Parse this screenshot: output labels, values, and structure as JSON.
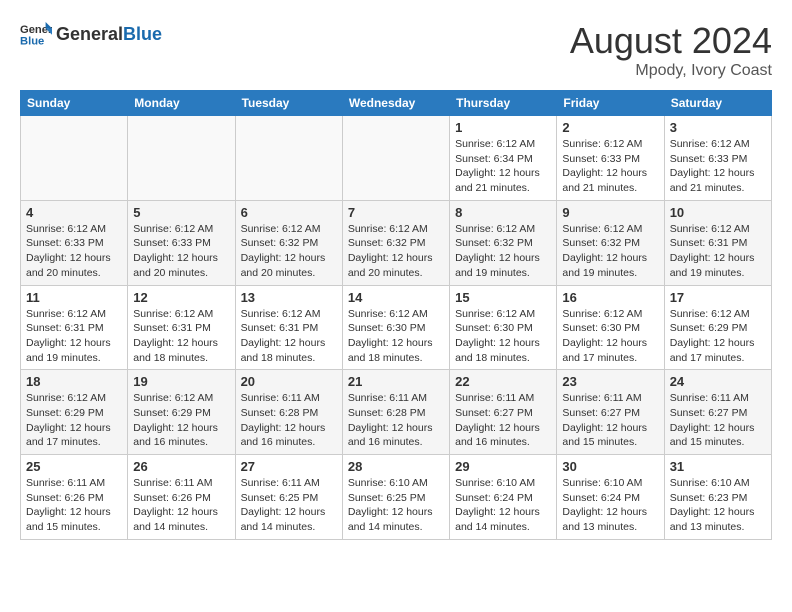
{
  "header": {
    "logo_general": "General",
    "logo_blue": "Blue",
    "month_year": "August 2024",
    "location": "Mpody, Ivory Coast"
  },
  "weekdays": [
    "Sunday",
    "Monday",
    "Tuesday",
    "Wednesday",
    "Thursday",
    "Friday",
    "Saturday"
  ],
  "weeks": [
    [
      {
        "day": "",
        "detail": ""
      },
      {
        "day": "",
        "detail": ""
      },
      {
        "day": "",
        "detail": ""
      },
      {
        "day": "",
        "detail": ""
      },
      {
        "day": "1",
        "detail": "Sunrise: 6:12 AM\nSunset: 6:34 PM\nDaylight: 12 hours\nand 21 minutes."
      },
      {
        "day": "2",
        "detail": "Sunrise: 6:12 AM\nSunset: 6:33 PM\nDaylight: 12 hours\nand 21 minutes."
      },
      {
        "day": "3",
        "detail": "Sunrise: 6:12 AM\nSunset: 6:33 PM\nDaylight: 12 hours\nand 21 minutes."
      }
    ],
    [
      {
        "day": "4",
        "detail": "Sunrise: 6:12 AM\nSunset: 6:33 PM\nDaylight: 12 hours\nand 20 minutes."
      },
      {
        "day": "5",
        "detail": "Sunrise: 6:12 AM\nSunset: 6:33 PM\nDaylight: 12 hours\nand 20 minutes."
      },
      {
        "day": "6",
        "detail": "Sunrise: 6:12 AM\nSunset: 6:32 PM\nDaylight: 12 hours\nand 20 minutes."
      },
      {
        "day": "7",
        "detail": "Sunrise: 6:12 AM\nSunset: 6:32 PM\nDaylight: 12 hours\nand 20 minutes."
      },
      {
        "day": "8",
        "detail": "Sunrise: 6:12 AM\nSunset: 6:32 PM\nDaylight: 12 hours\nand 19 minutes."
      },
      {
        "day": "9",
        "detail": "Sunrise: 6:12 AM\nSunset: 6:32 PM\nDaylight: 12 hours\nand 19 minutes."
      },
      {
        "day": "10",
        "detail": "Sunrise: 6:12 AM\nSunset: 6:31 PM\nDaylight: 12 hours\nand 19 minutes."
      }
    ],
    [
      {
        "day": "11",
        "detail": "Sunrise: 6:12 AM\nSunset: 6:31 PM\nDaylight: 12 hours\nand 19 minutes."
      },
      {
        "day": "12",
        "detail": "Sunrise: 6:12 AM\nSunset: 6:31 PM\nDaylight: 12 hours\nand 18 minutes."
      },
      {
        "day": "13",
        "detail": "Sunrise: 6:12 AM\nSunset: 6:31 PM\nDaylight: 12 hours\nand 18 minutes."
      },
      {
        "day": "14",
        "detail": "Sunrise: 6:12 AM\nSunset: 6:30 PM\nDaylight: 12 hours\nand 18 minutes."
      },
      {
        "day": "15",
        "detail": "Sunrise: 6:12 AM\nSunset: 6:30 PM\nDaylight: 12 hours\nand 18 minutes."
      },
      {
        "day": "16",
        "detail": "Sunrise: 6:12 AM\nSunset: 6:30 PM\nDaylight: 12 hours\nand 17 minutes."
      },
      {
        "day": "17",
        "detail": "Sunrise: 6:12 AM\nSunset: 6:29 PM\nDaylight: 12 hours\nand 17 minutes."
      }
    ],
    [
      {
        "day": "18",
        "detail": "Sunrise: 6:12 AM\nSunset: 6:29 PM\nDaylight: 12 hours\nand 17 minutes."
      },
      {
        "day": "19",
        "detail": "Sunrise: 6:12 AM\nSunset: 6:29 PM\nDaylight: 12 hours\nand 16 minutes."
      },
      {
        "day": "20",
        "detail": "Sunrise: 6:11 AM\nSunset: 6:28 PM\nDaylight: 12 hours\nand 16 minutes."
      },
      {
        "day": "21",
        "detail": "Sunrise: 6:11 AM\nSunset: 6:28 PM\nDaylight: 12 hours\nand 16 minutes."
      },
      {
        "day": "22",
        "detail": "Sunrise: 6:11 AM\nSunset: 6:27 PM\nDaylight: 12 hours\nand 16 minutes."
      },
      {
        "day": "23",
        "detail": "Sunrise: 6:11 AM\nSunset: 6:27 PM\nDaylight: 12 hours\nand 15 minutes."
      },
      {
        "day": "24",
        "detail": "Sunrise: 6:11 AM\nSunset: 6:27 PM\nDaylight: 12 hours\nand 15 minutes."
      }
    ],
    [
      {
        "day": "25",
        "detail": "Sunrise: 6:11 AM\nSunset: 6:26 PM\nDaylight: 12 hours\nand 15 minutes."
      },
      {
        "day": "26",
        "detail": "Sunrise: 6:11 AM\nSunset: 6:26 PM\nDaylight: 12 hours\nand 14 minutes."
      },
      {
        "day": "27",
        "detail": "Sunrise: 6:11 AM\nSunset: 6:25 PM\nDaylight: 12 hours\nand 14 minutes."
      },
      {
        "day": "28",
        "detail": "Sunrise: 6:10 AM\nSunset: 6:25 PM\nDaylight: 12 hours\nand 14 minutes."
      },
      {
        "day": "29",
        "detail": "Sunrise: 6:10 AM\nSunset: 6:24 PM\nDaylight: 12 hours\nand 14 minutes."
      },
      {
        "day": "30",
        "detail": "Sunrise: 6:10 AM\nSunset: 6:24 PM\nDaylight: 12 hours\nand 13 minutes."
      },
      {
        "day": "31",
        "detail": "Sunrise: 6:10 AM\nSunset: 6:23 PM\nDaylight: 12 hours\nand 13 minutes."
      }
    ]
  ]
}
